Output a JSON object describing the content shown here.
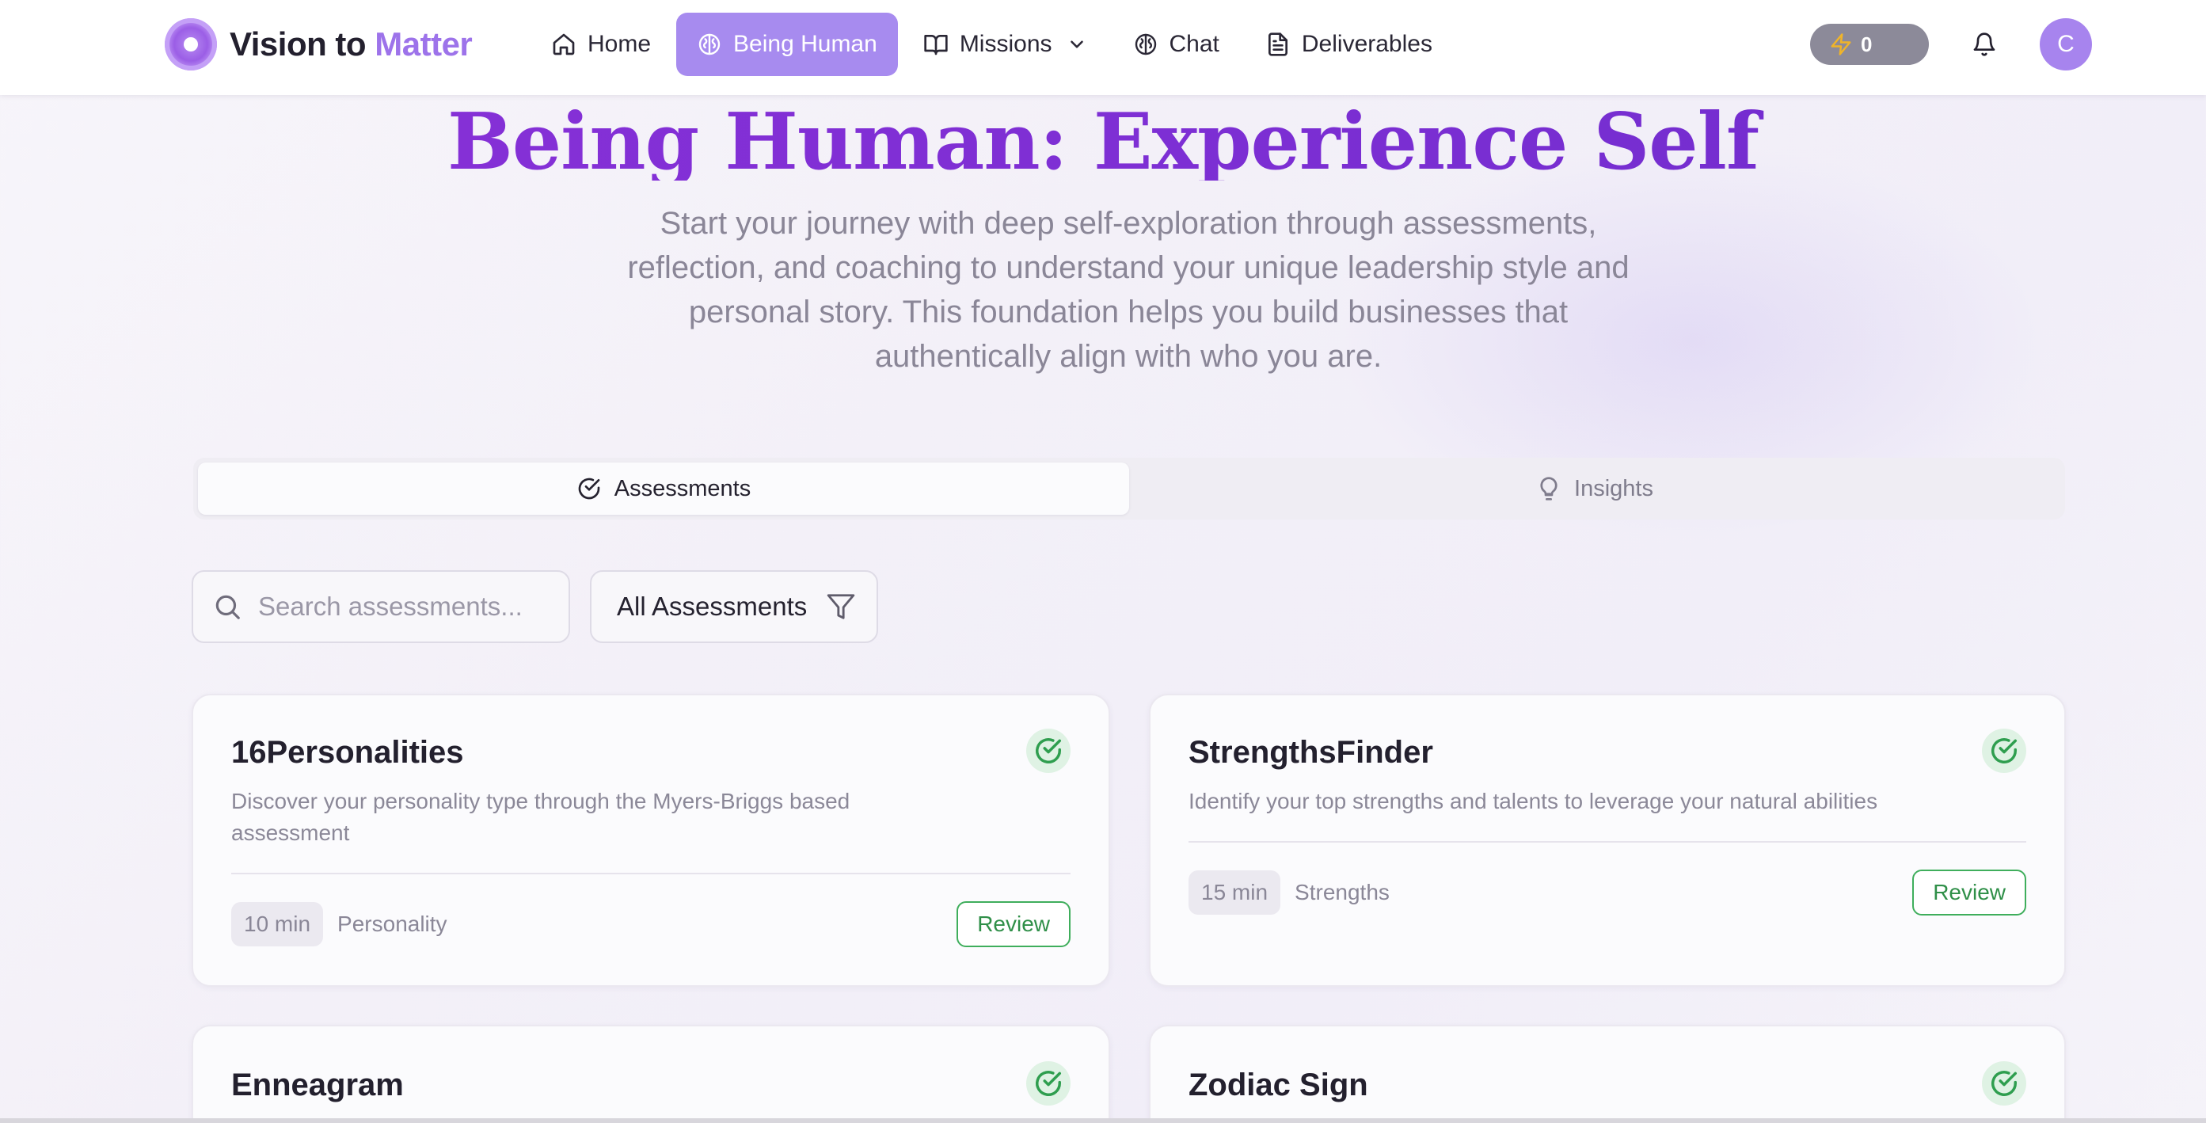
{
  "brand": {
    "part1": "Vision to",
    "part2": "Matter"
  },
  "nav": {
    "items": [
      {
        "label": "Home",
        "icon": "home-icon"
      },
      {
        "label": "Being Human",
        "icon": "brain-icon",
        "active": true
      },
      {
        "label": "Missions",
        "icon": "book-open-icon",
        "has_dropdown": true
      },
      {
        "label": "Chat",
        "icon": "brain-icon"
      },
      {
        "label": "Deliverables",
        "icon": "file-text-icon"
      }
    ],
    "energy_count": "0",
    "avatar_initial": "C"
  },
  "hero": {
    "title": "Being Human: Experience Self",
    "subtitle": "Start your journey with deep self-exploration through assessments, reflection, and coaching to understand your unique leadership style and personal story. This foundation helps you build businesses that authentically align with who you are."
  },
  "tabs": [
    {
      "label": "Assessments",
      "icon": "circle-check-icon",
      "active": true
    },
    {
      "label": "Insights",
      "icon": "lightbulb-icon",
      "active": false
    }
  ],
  "filters": {
    "search_placeholder": "Search assessments...",
    "select_value": "All Assessments"
  },
  "cards": [
    {
      "title": "16Personalities",
      "description": "Discover your personality type through the Myers-Briggs based assessment",
      "duration": "10 min",
      "category": "Personality",
      "button": "Review",
      "completed": true
    },
    {
      "title": "StrengthsFinder",
      "description": "Identify your top strengths and talents to leverage your natural abilities",
      "duration": "15 min",
      "category": "Strengths",
      "button": "Review",
      "completed": true
    },
    {
      "title": "Enneagram",
      "completed": true
    },
    {
      "title": "Zodiac Sign",
      "completed": true
    }
  ],
  "colors": {
    "accent": "#a78bef",
    "title_purple": "#7e2fd4",
    "success_green": "#2f8f48"
  }
}
